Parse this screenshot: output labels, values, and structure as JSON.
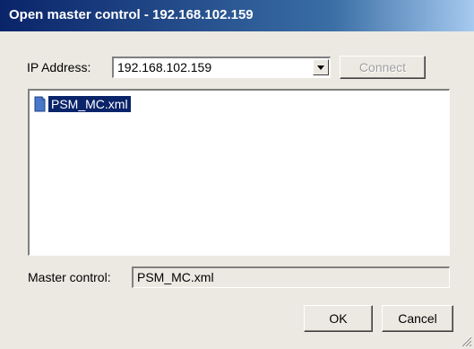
{
  "window": {
    "title": "Open master control - 192.168.102.159"
  },
  "ip_address": {
    "label": "IP Address:",
    "value": "192.168.102.159"
  },
  "buttons": {
    "connect": "Connect",
    "ok": "OK",
    "cancel": "Cancel"
  },
  "file_list": {
    "items": [
      {
        "name": "PSM_MC.xml",
        "selected": true,
        "icon": "file-icon"
      }
    ]
  },
  "master_control": {
    "label": "Master control:",
    "value": "PSM_MC.xml"
  },
  "colors": {
    "title_bar_start": "#0a246a",
    "title_bar_end": "#a6caf0",
    "selection": "#0a246a",
    "dialog_background": "#ece9e2"
  }
}
